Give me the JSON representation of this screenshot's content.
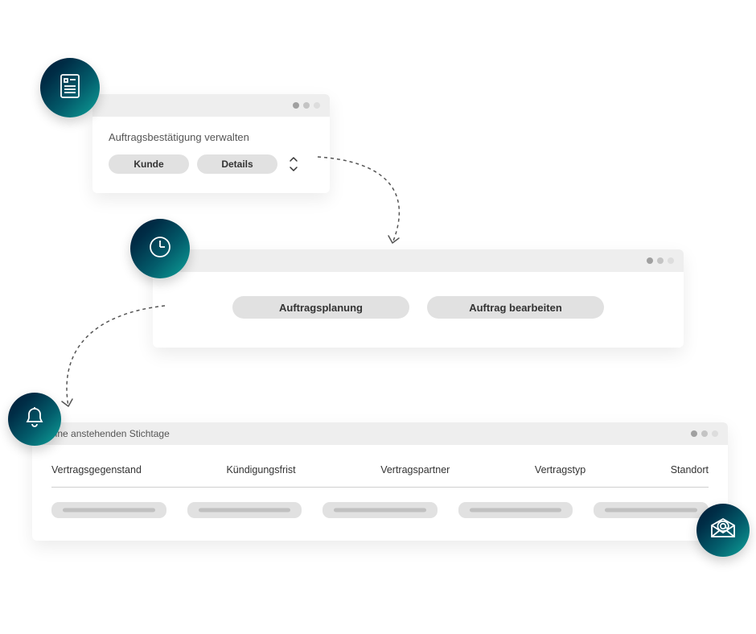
{
  "badges": {
    "document": "document-icon",
    "clock": "clock-icon",
    "bell": "bell-icon",
    "mail": "mail-icon"
  },
  "card1": {
    "subtitle": "Auftragsbestätigung verwalten",
    "pill_customer": "Kunde",
    "pill_details": "Details"
  },
  "card2": {
    "pill_planning": "Auftragsplanung",
    "pill_edit": "Auftrag bearbeiten"
  },
  "card3": {
    "title": "Meine anstehenden Stichtage",
    "columns": {
      "c1": "Vertragsgegenstand",
      "c2": "Kündigungsfrist",
      "c3": "Vertragspartner",
      "c4": "Vertragstyp",
      "c5": "Standort"
    }
  }
}
